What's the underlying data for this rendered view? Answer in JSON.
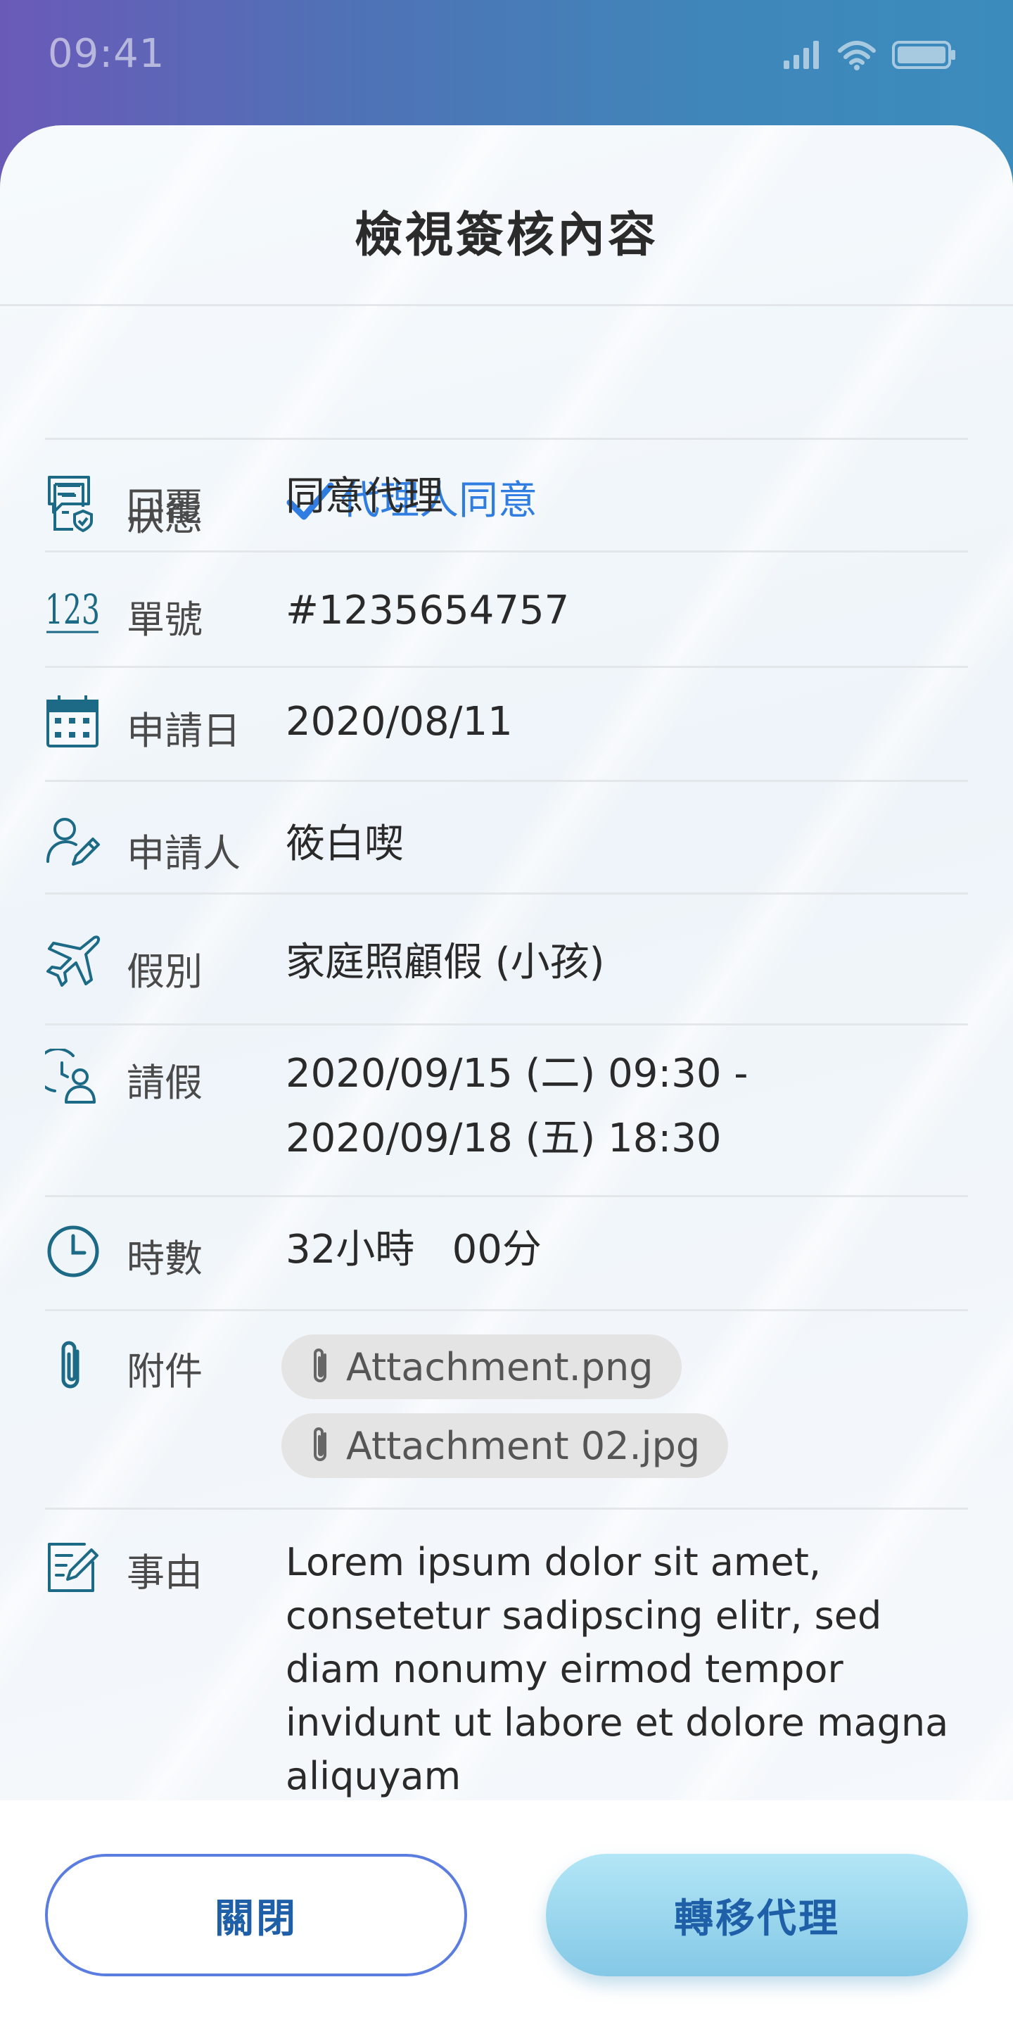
{
  "status_bar": {
    "time": "09:41"
  },
  "sheet": {
    "title": "檢視簽核內容"
  },
  "rows": {
    "status": {
      "label": "狀態",
      "value": "代理人同意"
    },
    "reply": {
      "label": "回覆",
      "value": "同意代理"
    },
    "order_no": {
      "label": "單號",
      "value": "#1235654757"
    },
    "apply_date": {
      "label": "申請日",
      "value": "2020/08/11"
    },
    "applicant": {
      "label": "申請人",
      "value": "筱白喫"
    },
    "leave_type": {
      "label": "假別",
      "value": "家庭照顧假 (小孩)"
    },
    "leave_period": {
      "label": "請假",
      "value_line1": "2020/09/15 (二)  09:30 -",
      "value_line2": "2020/09/18 (五)  18:30"
    },
    "hours": {
      "label": "時數",
      "value": "32小時   00分"
    },
    "attachments": {
      "label": "附件",
      "files": [
        "Attachment.png",
        "Attachment 02.jpg"
      ]
    },
    "reason": {
      "label": "事由",
      "value": "Lorem ipsum dolor sit amet, consetetur sadipscing elitr, sed diam nonumy eirmod tempor invidunt ut labore et dolore magna aliquyam"
    }
  },
  "footer": {
    "close_label": "關閉",
    "transfer_label": "轉移代理"
  },
  "colors": {
    "accent_blue": "#2f7de0",
    "icon_teal": "#1c6a86",
    "button_border": "#5b7de0"
  }
}
